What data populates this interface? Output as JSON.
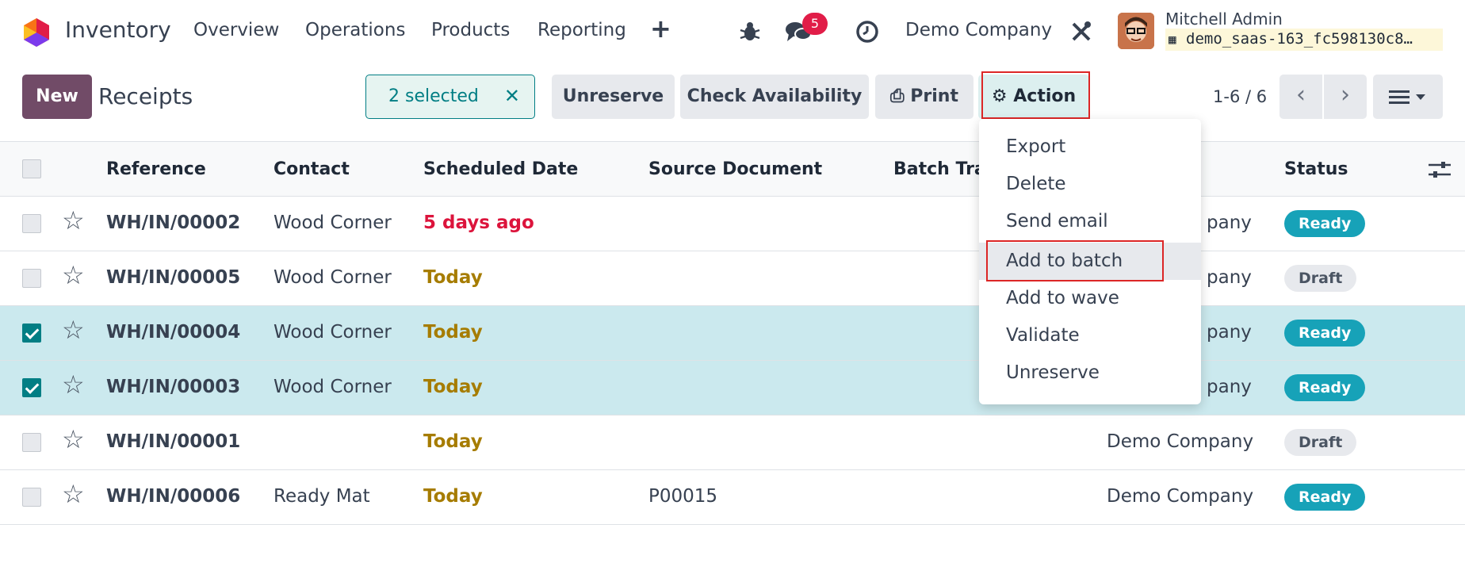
{
  "app": {
    "name": "Inventory"
  },
  "menu": [
    "Overview",
    "Operations",
    "Products",
    "Reporting"
  ],
  "navbar": {
    "message_count": "5",
    "company": "Demo Company",
    "user_name": "Mitchell Admin",
    "db_name": "demo_saas-163_fc598130c8…"
  },
  "control": {
    "new_label": "New",
    "title": "Receipts",
    "selected_label": "2 selected",
    "unreserve_label": "Unreserve",
    "check_label": "Check Availability",
    "print_label": "Print",
    "action_label": "Action",
    "pager": "1-6 / 6"
  },
  "columns": {
    "reference": "Reference",
    "contact": "Contact",
    "scheduled_date": "Scheduled Date",
    "source_document": "Source Document",
    "batch": "Batch Tra",
    "status": "Status"
  },
  "rows": [
    {
      "reference": "WH/IN/00002",
      "contact": "Wood Corner",
      "date": "5 days ago",
      "source": "",
      "company": "Demo Company",
      "status": "Ready",
      "selected": false
    },
    {
      "reference": "WH/IN/00005",
      "contact": "Wood Corner",
      "date": "Today",
      "source": "",
      "company": "Demo Company",
      "status": "Draft",
      "selected": false
    },
    {
      "reference": "WH/IN/00004",
      "contact": "Wood Corner",
      "date": "Today",
      "source": "",
      "company": "Demo Company",
      "status": "Ready",
      "selected": true
    },
    {
      "reference": "WH/IN/00003",
      "contact": "Wood Corner",
      "date": "Today",
      "source": "",
      "company": "Demo Company",
      "status": "Ready",
      "selected": true
    },
    {
      "reference": "WH/IN/00001",
      "contact": "",
      "date": "Today",
      "source": "",
      "company": "Demo Company",
      "status": "Draft",
      "selected": false
    },
    {
      "reference": "WH/IN/00006",
      "contact": "Ready Mat",
      "date": "Today",
      "source": "P00015",
      "company": "Demo Company",
      "status": "Ready",
      "selected": false
    }
  ],
  "partial_company": "pany",
  "dropdown": [
    "Export",
    "Delete",
    "Send email",
    "Add to batch",
    "Add to wave",
    "Validate",
    "Unreserve"
  ],
  "colors": {
    "brand": "#714b67",
    "accent": "#017e84",
    "ready": "#17a2b8",
    "late": "#dc143c",
    "today": "#a67c00"
  }
}
